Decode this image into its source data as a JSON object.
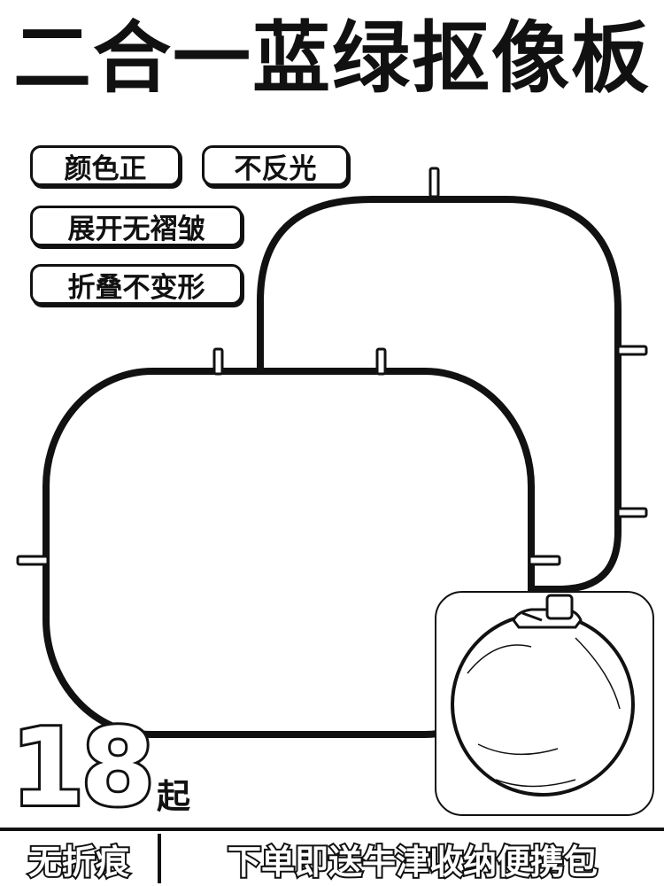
{
  "title": "二合一蓝绿抠像板",
  "features": [
    "颜色正",
    "不反光",
    "展开无褶皱",
    "折叠不变形"
  ],
  "price": {
    "number": "18",
    "unit": "起"
  },
  "bottom_bar": {
    "left": "无折痕",
    "right": "下单即送牛津收纳便携包"
  },
  "colors": {
    "ink": "#111111",
    "background": "#ffffff"
  },
  "icons": {
    "backdrop": "collapsible-backdrop-icon",
    "bag": "storage-bag-icon"
  }
}
